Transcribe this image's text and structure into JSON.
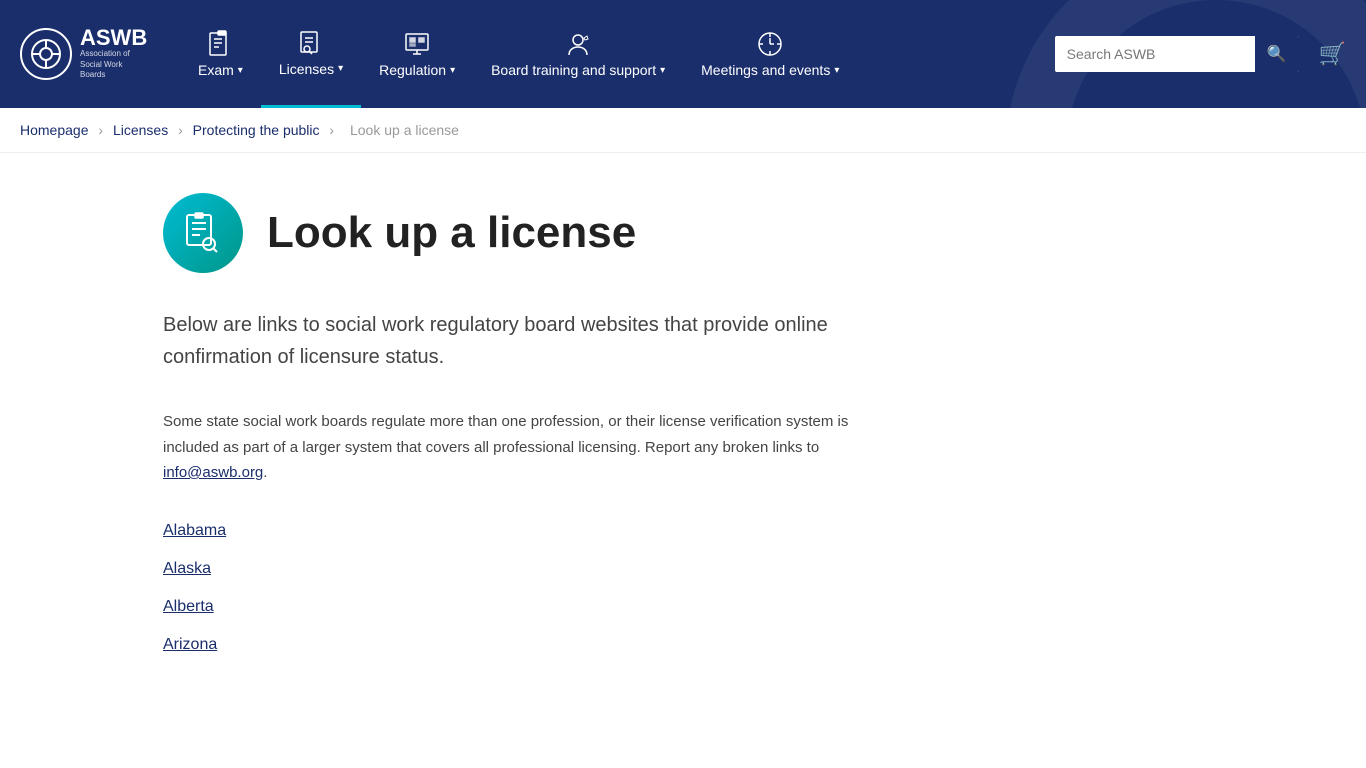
{
  "site": {
    "title": "ASWB",
    "subtitle": "Association of Social Work Boards"
  },
  "nav": {
    "search_placeholder": "Search ASWB",
    "items": [
      {
        "id": "exam",
        "label": "Exam",
        "has_dropdown": true,
        "active": false
      },
      {
        "id": "licenses",
        "label": "Licenses",
        "has_dropdown": true,
        "active": true
      },
      {
        "id": "regulation",
        "label": "Regulation",
        "has_dropdown": true,
        "active": false
      },
      {
        "id": "board-training",
        "label": "Board training and support",
        "has_dropdown": true,
        "active": false
      },
      {
        "id": "meetings",
        "label": "Meetings and events",
        "has_dropdown": true,
        "active": false
      }
    ]
  },
  "breadcrumb": {
    "items": [
      {
        "label": "Homepage",
        "href": "#"
      },
      {
        "label": "Licenses",
        "href": "#"
      },
      {
        "label": "Protecting the public",
        "href": "#"
      },
      {
        "label": "Look up a license",
        "href": "#"
      }
    ]
  },
  "page": {
    "title": "Look up a license",
    "intro": "Below are links to social work regulatory board websites that provide online confirmation of licensure status.",
    "body": "Some state social work boards regulate more than one profession, or their license verification system is included as part of a larger system that covers all professional licensing. Report any broken links to",
    "email": "info@aswb.org",
    "email_suffix": ".",
    "links": [
      {
        "label": "Alabama",
        "href": "#"
      },
      {
        "label": "Alaska",
        "href": "#"
      },
      {
        "label": "Alberta",
        "href": "#"
      },
      {
        "label": "Arizona",
        "href": "#"
      }
    ]
  }
}
